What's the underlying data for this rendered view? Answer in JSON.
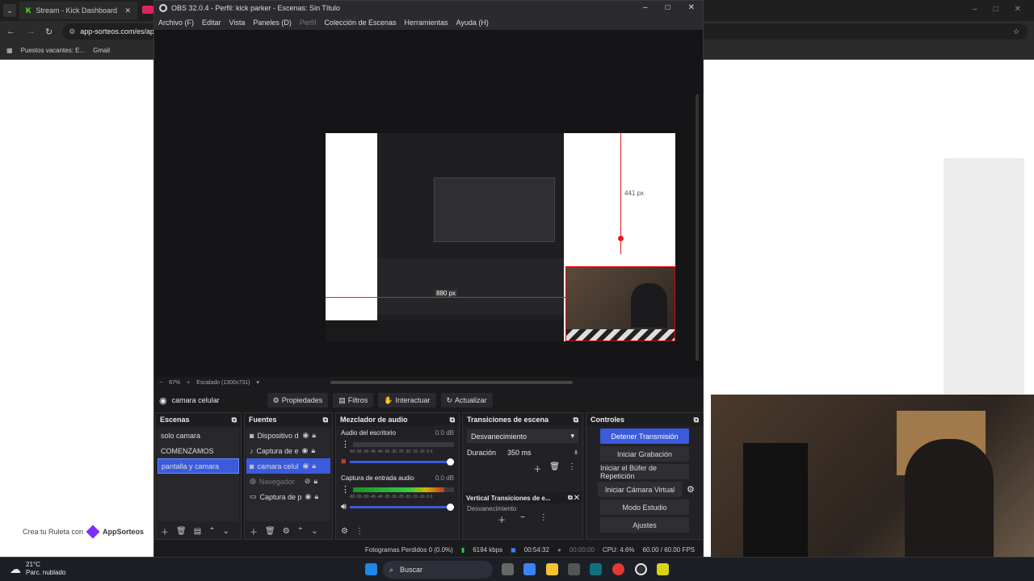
{
  "browser": {
    "tabs": [
      {
        "label": "Stream - Kick Dashboard",
        "active": false
      }
    ],
    "url": "app-sorteos.com/es/ap",
    "bookmarks": [
      "Puestos vacantes: E...",
      "Gmail"
    ]
  },
  "page": {
    "footer_text": "Crea tu Ruleta con",
    "footer_brand": "AppSorteos"
  },
  "obs": {
    "title": "OBS 32.0.4 - Perfil: kick parker - Escenas: Sin Título",
    "menu": [
      {
        "label": "Archivo (F)",
        "enabled": true
      },
      {
        "label": "Editar",
        "enabled": true
      },
      {
        "label": "Vista",
        "enabled": true
      },
      {
        "label": "Paneles (D)",
        "enabled": true
      },
      {
        "label": "Perfil",
        "enabled": false
      },
      {
        "label": "Colección de Escenas",
        "enabled": true
      },
      {
        "label": "Herramientas",
        "enabled": true
      },
      {
        "label": "Ayuda (H)",
        "enabled": true
      }
    ],
    "preview": {
      "measure_v": "441 px",
      "measure_h": "880 px"
    },
    "zoom": {
      "minus": "−",
      "level": "67%",
      "plus": "+",
      "scaling": "Escalado (1300x731)"
    },
    "context": {
      "source_name": "camara celular",
      "buttons": [
        "Propiedades",
        "Filtros",
        "Interactuar",
        "Actualizar"
      ]
    },
    "scenes": {
      "title": "Escenas",
      "items": [
        {
          "label": "solo camara",
          "selected": false
        },
        {
          "label": "COMENZAMOS",
          "selected": false
        },
        {
          "label": "pantalla y camara",
          "selected": true
        }
      ]
    },
    "sources": {
      "title": "Fuentes",
      "items": [
        {
          "label": "Dispositivo de",
          "icon": "camera-icon",
          "selected": false,
          "visible": true
        },
        {
          "label": "Captura de er",
          "icon": "microphone-icon",
          "selected": false,
          "visible": true
        },
        {
          "label": "camara celula",
          "icon": "camera-icon",
          "selected": true,
          "visible": true
        },
        {
          "label": "Navegador",
          "icon": "globe-icon",
          "selected": false,
          "visible": false
        },
        {
          "label": "Captura de pa",
          "icon": "monitor-icon",
          "selected": false,
          "visible": true
        }
      ]
    },
    "mixer": {
      "title": "Mezclador de audio",
      "channels": [
        {
          "name": "Audio del escritorio",
          "db": "0.0 dB",
          "level": 0,
          "muted": true
        },
        {
          "name": "Captura de entrada audio",
          "db": "0.0 dB",
          "level": 0.9,
          "muted": false
        }
      ],
      "scale": "-60 -55 -50 -45 -40 -35 -30 -25 -20 -15 -10 -5 0"
    },
    "transitions": {
      "title": "Transiciones de escena",
      "selected": "Desvanecimiento",
      "duration_label": "Duración",
      "duration_value": "350 ms",
      "vertical_title": "Vertical Transiciones de e...",
      "vertical_selected": "Desvanecimiento"
    },
    "controls": {
      "title": "Controles",
      "buttons": [
        {
          "label": "Detener Transmisión",
          "primary": true
        },
        {
          "label": "Iniciar Grabación",
          "primary": false
        },
        {
          "label": "Iniciar el Búfer de Repetición",
          "primary": false
        },
        {
          "label": "Iniciar Cámara Virtual",
          "primary": false
        },
        {
          "label": "Modo Estudio",
          "primary": false
        },
        {
          "label": "Ajustes",
          "primary": false
        }
      ]
    },
    "status": {
      "dropped": "Fotogramas Perdidos 0 (0.0%)",
      "bitrate": "6194 kbps",
      "stream_time": "00:54:32",
      "rec_time": "00:00:00",
      "cpu": "CPU: 4.6%",
      "fps": "60.00 / 60.00 FPS"
    }
  },
  "taskbar": {
    "weather_temp": "21°C",
    "weather_desc": "Parc. nublado",
    "search": "Buscar"
  }
}
